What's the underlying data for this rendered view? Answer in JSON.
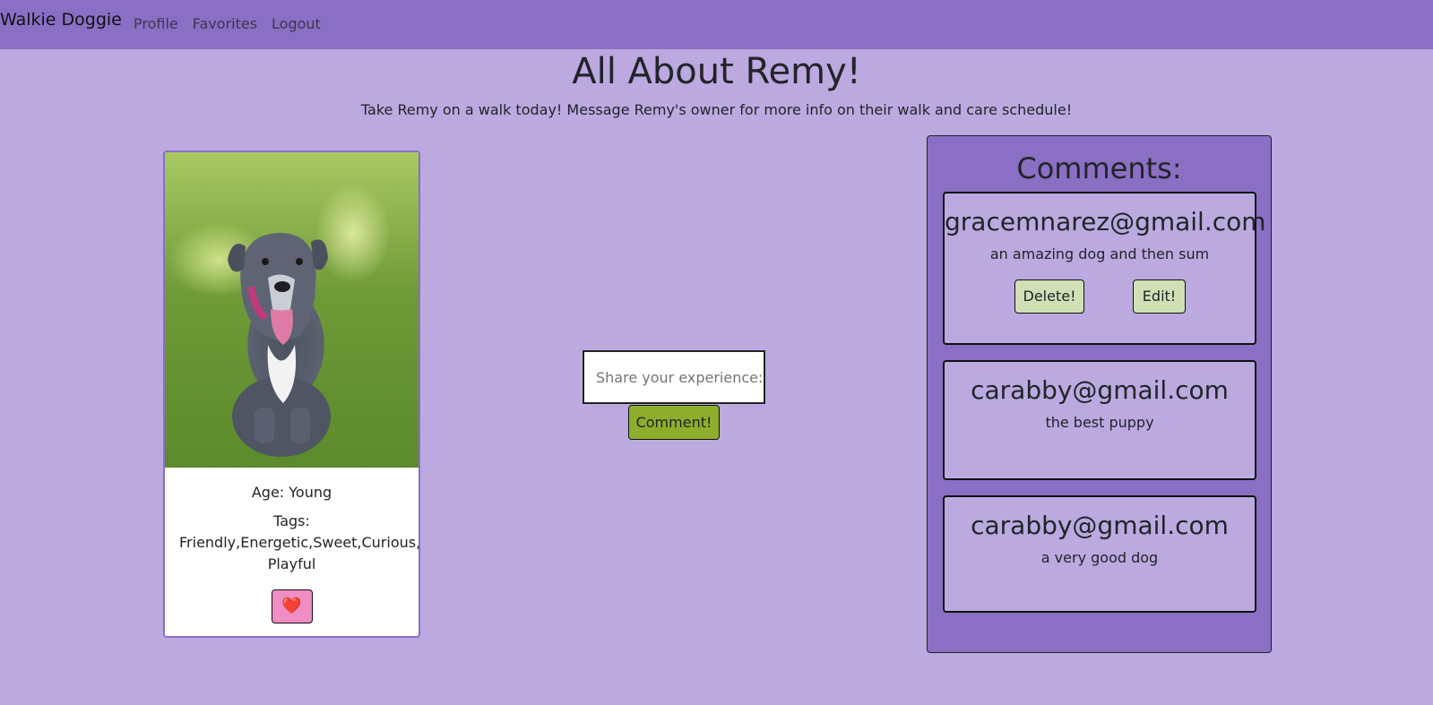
{
  "nav": {
    "brand": "Walkie Doggie",
    "links": [
      "Profile",
      "Favorites",
      "Logout"
    ]
  },
  "page": {
    "title": "All About Remy!",
    "subtitle": "Take Remy on a walk today! Message Remy's owner for more info on their walk and care schedule!"
  },
  "dog": {
    "age": "Age: Young",
    "tags_line1": "Tags:",
    "tags_line2": "Friendly,Energetic,Sweet,Curious,",
    "tags_line3": "Playful",
    "favorite_icon": "heart-icon",
    "favorite_glyph": "❤️"
  },
  "comment_form": {
    "placeholder": "Share your experience:",
    "button_label": "Comment!"
  },
  "comments": {
    "title": "Comments:",
    "items": [
      {
        "author": "gracemnarez@gmail.com",
        "text": "an amazing dog and then sum",
        "delete_label": "Delete!",
        "edit_label": "Edit!"
      },
      {
        "author": "carabby@gmail.com",
        "text": "the best puppy"
      },
      {
        "author": "carabby@gmail.com",
        "text": "a very good dog"
      }
    ]
  },
  "colors": {
    "navbar": "#8a6fc4",
    "background": "#bba9e0",
    "comment_button": "#8cae2c",
    "favorite_button": "#ef8dc4",
    "action_buttons": "#cfe0b4"
  }
}
